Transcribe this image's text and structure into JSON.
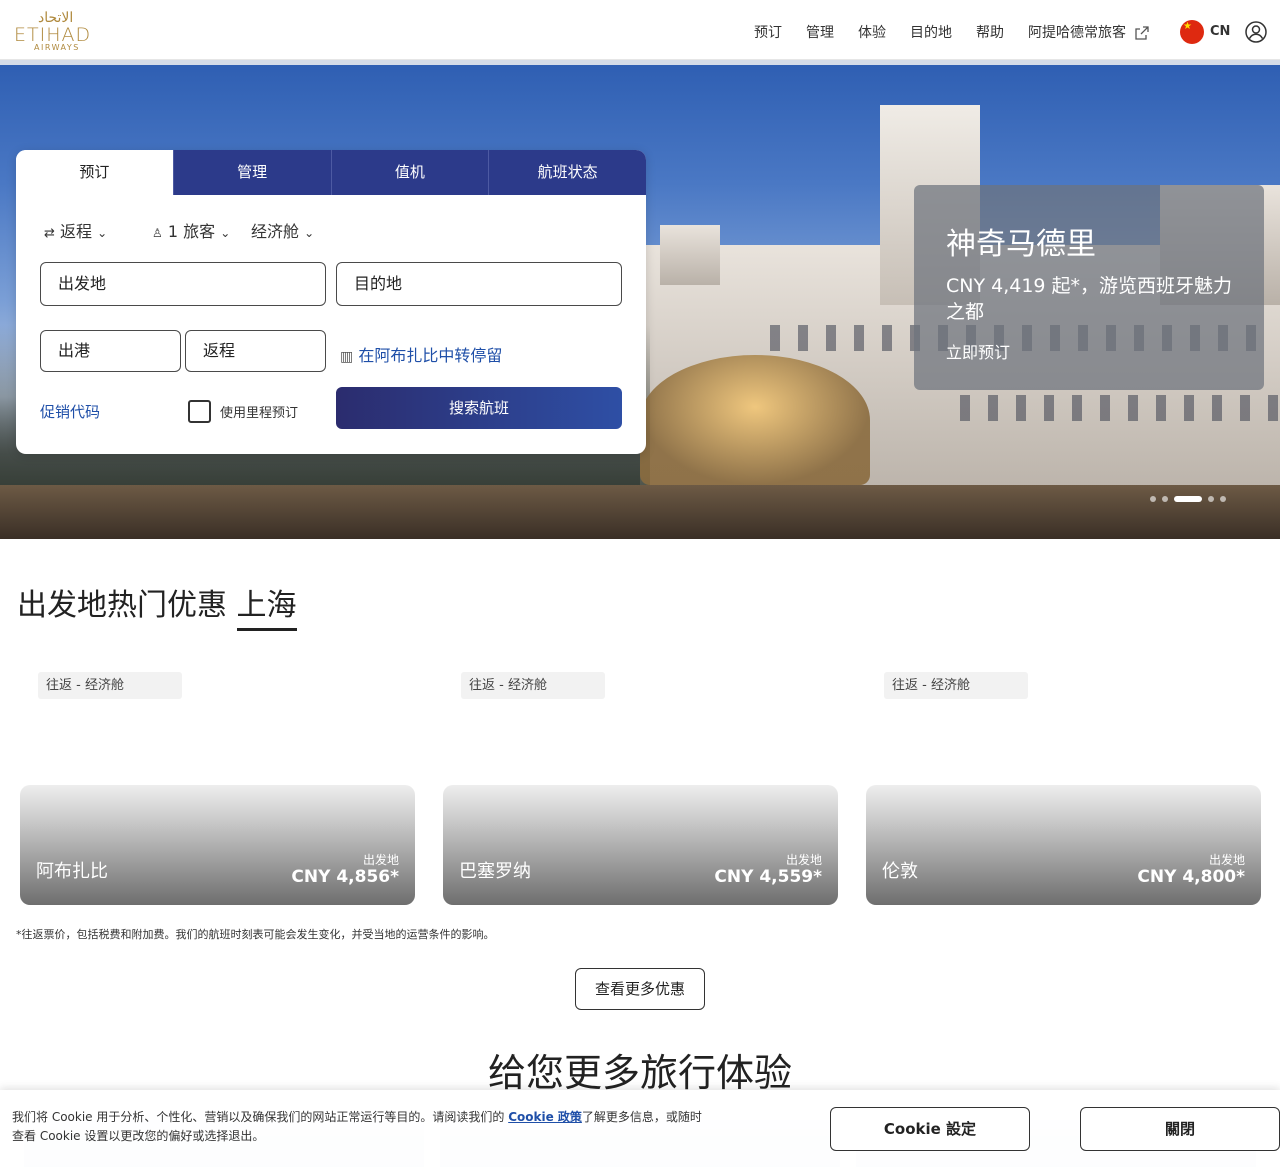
{
  "header": {
    "logo": {
      "arabic": "الاتحاد",
      "name": "ETIHAD",
      "sub": "AIRWAYS"
    },
    "nav": [
      "预订",
      "管理",
      "体验",
      "目的地",
      "帮助",
      "阿提哈德常旅客"
    ],
    "language": "CN"
  },
  "hero": {
    "promo": {
      "title": "神奇马德里",
      "description": "CNY 4,419 起*，游览西班牙魅力之都",
      "cta": "立即预订"
    }
  },
  "booking": {
    "tabs": [
      "预订",
      "管理",
      "值机",
      "航班状态"
    ],
    "trip_type": "返程",
    "passengers": "1 旅客",
    "cabin": "经济舱",
    "origin_placeholder": "出发地",
    "destination_placeholder": "目的地",
    "depart_placeholder": "出港",
    "return_placeholder": "返程",
    "stopover": "在阿布扎比中转停留",
    "promo_code": "促销代码",
    "miles_label": "使用里程预订",
    "search": "搜索航班"
  },
  "deals": {
    "heading": "出发地热门优惠",
    "city": "上海",
    "cards": [
      {
        "tag": "往返 - 经济舱",
        "city": "阿布扎比",
        "from": "出发地",
        "price": "CNY 4,856*"
      },
      {
        "tag": "往返 - 经济舱",
        "city": "巴塞罗纳",
        "from": "出发地",
        "price": "CNY 4,559*"
      },
      {
        "tag": "往返 - 经济舱",
        "city": "伦敦",
        "from": "出发地",
        "price": "CNY 4,800*"
      }
    ],
    "disclaimer": "*往返票价，包括税费和附加费。我们的航班时刻表可能会发生变化，并受当地的运营条件的影响。",
    "more": "查看更多优惠"
  },
  "experience": {
    "heading": "给您更多旅行体验"
  },
  "cookie": {
    "text_before": "我们将 Cookie 用于分析、个性化、营销以及确保我们的网站正常运行等目的。请阅读我们的 ",
    "link": "Cookie 政策",
    "text_after": "了解更多信息，或随时查看 Cookie 设置以更改您的偏好或选择退出。",
    "settings": "Cookie 設定",
    "close": "關閉"
  }
}
